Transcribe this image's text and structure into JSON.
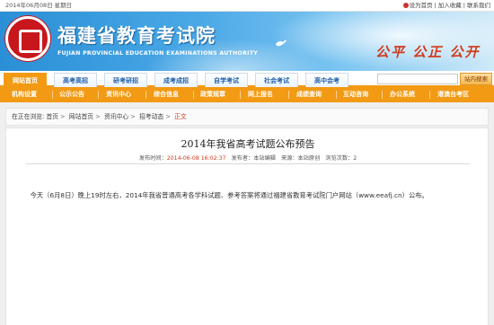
{
  "topbar": {
    "date": "2014年06月08日  星期日",
    "links": [
      "设为首页",
      "加入收藏",
      "联系我们"
    ]
  },
  "banner": {
    "title": "福建省教育考试院",
    "subtitle": "FUJIAN PROVINCIAL EDUCATION EXAMINATIONS AUTHORITY",
    "slogan": "公平 公正 公开",
    "logo_icon": "exam-authority-seal-icon",
    "dove_icon": "dove-icon"
  },
  "nav_primary": {
    "tabs": [
      "网站首页",
      "高考高招",
      "研考研招",
      "成考成招",
      "自学考试",
      "社会考试",
      "高中会考"
    ],
    "active_index": 0,
    "search_button": "站内搜索"
  },
  "nav_secondary": {
    "items": [
      "机构设置",
      "公示公告",
      "资讯中心",
      "综合信息",
      "政策规章",
      "网上报名",
      "成绩查询",
      "互动咨询",
      "办公系统",
      "港澳台考区"
    ]
  },
  "breadcrumb": {
    "prefix": "在正在浏览:",
    "items": [
      "首页",
      "网站首页",
      "资讯中心",
      "招考动态"
    ],
    "current": "正文"
  },
  "article": {
    "title": "2014年我省高考试题公布预告",
    "publish_label": "发布时间：",
    "publish_time": "2014-06-08 16:02:37",
    "publisher_label": "发布者：",
    "publisher": "本站编辑",
    "source_label": "来源：",
    "source": "本站原创",
    "views_label": "浏览次数：",
    "views": "2",
    "body": "今天（6月8日）晚上19时左右，2014年我省普通高考各学科试题、参考答案将通过福建省教育考试院门户网站（www.eeafj.cn）公布。"
  },
  "colors": {
    "brand_orange": "#f29a13",
    "brand_blue": "#1f5ea8",
    "accent_red": "#d23a1b"
  }
}
